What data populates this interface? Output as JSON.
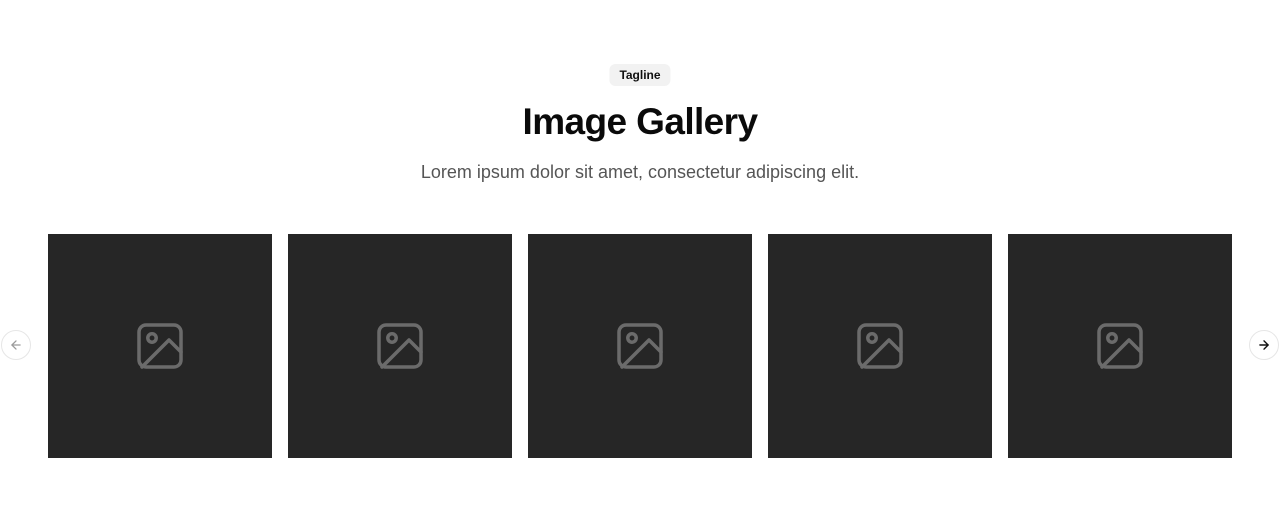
{
  "header": {
    "tagline": "Tagline",
    "title": "Image Gallery",
    "subtitle": "Lorem ipsum dolor sit amet, consectetur adipiscing elit."
  },
  "gallery": {
    "items": [
      {
        "icon": "image-placeholder-icon"
      },
      {
        "icon": "image-placeholder-icon"
      },
      {
        "icon": "image-placeholder-icon"
      },
      {
        "icon": "image-placeholder-icon"
      },
      {
        "icon": "image-placeholder-icon"
      }
    ],
    "tile_color": "#262626",
    "icon_color": "#6b6b6b"
  },
  "navigation": {
    "prev_icon": "arrow-left-icon",
    "next_icon": "arrow-right-icon",
    "prev_color": "#9a9a9a",
    "next_color": "#111111"
  }
}
